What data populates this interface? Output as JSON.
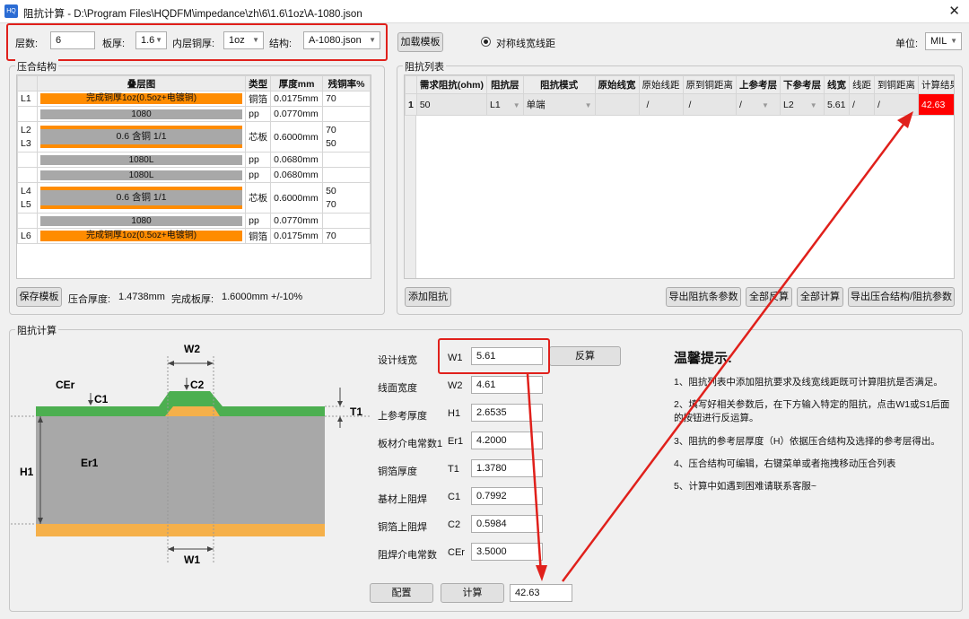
{
  "window": {
    "icon_text": "HQ",
    "title": "阻抗计算 - D:\\Program Files\\HQDFM\\impedance\\zh\\6\\1.6\\1oz\\A-1080.json",
    "close": "✕"
  },
  "toolbar": {
    "layers_label": "层数:",
    "layers_value": "6",
    "thickness_label": "板厚:",
    "thickness_value": "1.6",
    "inner_cu_label": "内层铜厚:",
    "inner_cu_value": "1oz",
    "structure_label": "结构:",
    "structure_value": "A-1080.json",
    "load_template": "加载模板",
    "symmetric_label": "对称线宽线距",
    "unit_label": "单位:",
    "unit_value": "MIL"
  },
  "stackup": {
    "group_title": "压合结构",
    "headers": [
      "叠层图",
      "类型",
      "厚度mm",
      "残铜率%"
    ],
    "rows": [
      {
        "layer": "L1",
        "bar": "完成铜厚1oz(0.5oz+电镀铜)",
        "type": "铜箔",
        "thk": "0.0175mm",
        "res": "70"
      },
      {
        "layer": "",
        "bar": "1080",
        "type": "pp",
        "thk": "0.0770mm",
        "res": ""
      },
      {
        "layer": "L2",
        "layer2": "L3",
        "bar": "0.6 含铜 1/1",
        "type": "芯板",
        "thk": "0.6000mm",
        "res": "70",
        "res2": "50"
      },
      {
        "layer": "",
        "bar": "1080L",
        "type": "pp",
        "thk": "0.0680mm",
        "res": ""
      },
      {
        "layer": "",
        "bar": "1080L",
        "type": "pp",
        "thk": "0.0680mm",
        "res": ""
      },
      {
        "layer": "L4",
        "layer2": "L5",
        "bar": "0.6 含铜 1/1",
        "type": "芯板",
        "thk": "0.6000mm",
        "res": "50",
        "res2": "70"
      },
      {
        "layer": "",
        "bar": "1080",
        "type": "pp",
        "thk": "0.0770mm",
        "res": ""
      },
      {
        "layer": "L6",
        "bar": "完成铜厚1oz(0.5oz+电镀铜)",
        "type": "铜箔",
        "thk": "0.0175mm",
        "res": "70"
      }
    ],
    "save_template": "保存模板",
    "press_label": "压合厚度:",
    "press_value": "1.4738mm",
    "finish_label": "完成板厚:",
    "finish_value": "1.6000mm +/-10%"
  },
  "imp_list": {
    "group_title": "阻抗列表",
    "headers": [
      "需求阻抗(ohm)",
      "阻抗层",
      "阻抗模式",
      "原始线宽",
      "原始线距",
      "原到铜距离",
      "上参考层",
      "下参考层",
      "线宽",
      "线距",
      "到铜距离",
      "计算结果"
    ],
    "row": {
      "idx": "1",
      "req": "50",
      "layer": "L1",
      "mode": "单端",
      "w0": "",
      "s0": "/",
      "d0": "/",
      "ref_up": "/",
      "ref_down": "L2",
      "w": "5.61",
      "s": "/",
      "d": "/",
      "result": "42.63"
    },
    "buttons": [
      "添加阻抗",
      "导出阻抗条参数",
      "全部反算",
      "全部计算",
      "导出压合结构/阻抗参数"
    ]
  },
  "calc": {
    "group_title": "阻抗计算",
    "diagram": {
      "W2": "W2",
      "C2": "C2",
      "CEr": "CEr",
      "C1": "C1",
      "T1": "T1",
      "H1": "H1",
      "Er1": "Er1",
      "W1": "W1"
    },
    "params": [
      {
        "label": "设计线宽",
        "sym": "W1",
        "value": "5.61"
      },
      {
        "label": "线面宽度",
        "sym": "W2",
        "value": "4.61"
      },
      {
        "label": "上参考厚度",
        "sym": "H1",
        "value": "2.6535"
      },
      {
        "label": "板材介电常数1",
        "sym": "Er1",
        "value": "4.2000"
      },
      {
        "label": "铜箔厚度",
        "sym": "T1",
        "value": "1.3780"
      },
      {
        "label": "基材上阻焊",
        "sym": "C1",
        "value": "0.7992"
      },
      {
        "label": "铜箔上阻焊",
        "sym": "C2",
        "value": "0.5984"
      },
      {
        "label": "阻焊介电常数",
        "sym": "CEr",
        "value": "3.5000"
      }
    ],
    "reverse_button": "反算",
    "config_button": "配置",
    "calc_button": "计算",
    "result_value": "42.63"
  },
  "tips": {
    "title": "温馨提示:",
    "items": [
      "1、阻抗列表中添加阻抗要求及线宽线距既可计算阻抗是否满足。",
      "2、填写好相关参数后，在下方输入特定的阻抗，点击W1或S1后面的按钮进行反运算。",
      "3、阻抗的参考层厚度（H）依据压合结构及选择的参考层得出。",
      "4、压合结构可编辑，右键菜单或者拖拽移动压合列表",
      "5、计算中如遇到困难请联系客服~"
    ]
  },
  "colors": {
    "copper_bar": "#ff8c00",
    "pp_bar": "#a8a8a8",
    "soldermask": "#4caf50",
    "result_bg": "#ff0000",
    "annotation": "#e0201b"
  }
}
